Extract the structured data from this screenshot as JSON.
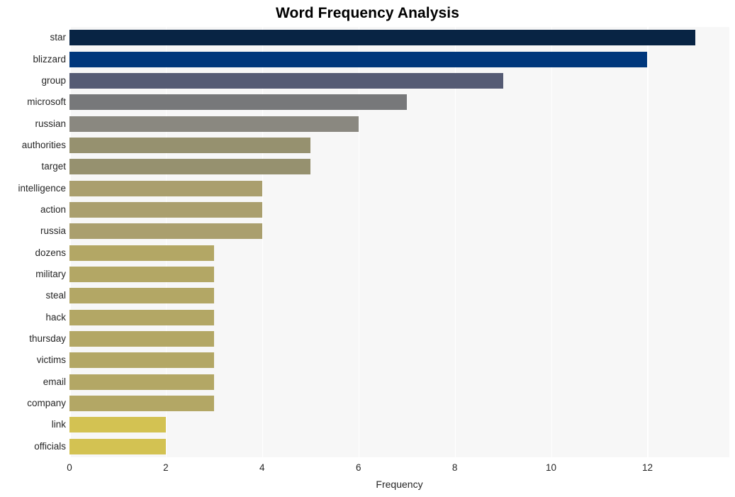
{
  "chart_data": {
    "type": "bar",
    "orientation": "horizontal",
    "title": "Word Frequency Analysis",
    "xlabel": "Frequency",
    "ylabel": "",
    "xlim": [
      0,
      13.7
    ],
    "ylim": [
      0,
      20
    ],
    "grid": true,
    "legend": null,
    "xticks": [
      "0",
      "2",
      "4",
      "6",
      "8",
      "10",
      "12"
    ],
    "xtick_values": [
      0,
      2,
      4,
      6,
      8,
      10,
      12
    ],
    "categories": [
      "star",
      "blizzard",
      "group",
      "microsoft",
      "russian",
      "authorities",
      "target",
      "intelligence",
      "action",
      "russia",
      "dozens",
      "military",
      "steal",
      "hack",
      "thursday",
      "victims",
      "email",
      "company",
      "link",
      "officials"
    ],
    "values": [
      13,
      12,
      9,
      7,
      6,
      5,
      5,
      4,
      4,
      4,
      3,
      3,
      3,
      3,
      3,
      3,
      3,
      3,
      2,
      2
    ],
    "bar_colors": [
      "#082444",
      "#00377c",
      "#555b74",
      "#77787a",
      "#8a8880",
      "#96916f",
      "#96916f",
      "#aa9f6e",
      "#aa9f6e",
      "#aa9f6e",
      "#b3a765",
      "#b3a765",
      "#b3a765",
      "#b3a765",
      "#b3a765",
      "#b3a765",
      "#b3a765",
      "#b3a765",
      "#d3c252",
      "#d3c252"
    ],
    "plot_background": "#f7f7f7",
    "gridline_color": "#ffffff",
    "figure_background": "#ffffff",
    "text_color": "#262626",
    "title_color": "#000000"
  }
}
